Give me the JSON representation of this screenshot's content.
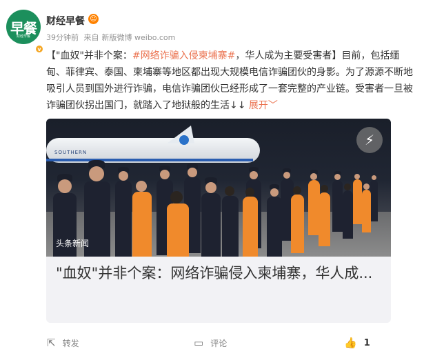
{
  "author": {
    "name": "财经早餐",
    "avatar_text": "早餐",
    "avatar_subtext": "财经早餐",
    "verify_badge": "v",
    "badge_icon": "emoji-badge-icon"
  },
  "meta": {
    "time": "39分钟前",
    "source_prefix": "来自",
    "source": "新版微博 weibo.com"
  },
  "post": {
    "prefix": "【\"血奴\"并非个案：",
    "hashtag": "#网络诈骗入侵柬埔寨#",
    "middle": "，华人成为主要受害者】目前，包括缅甸、菲律宾、泰国、柬埔寨等地区都出现大规模电信诈骗团伙的身影。为了源源不断地吸引人员到国外进行诈骗，电信诈骗团伙已经形成了一套完整的产业链。受害者一旦被诈骗团伙拐出国门，就踏入了地狱般的生活↓↓",
    "expand": "展开"
  },
  "link_card": {
    "watermark": "头条新闻",
    "title": "\"血奴\"并非个案：网络诈骗侵入柬埔寨，华人成...",
    "plane_text": "SOUTHERN"
  },
  "actions": {
    "share": "转发",
    "comment": "评论",
    "like_count": "1"
  },
  "colors": {
    "accent": "#eb7350",
    "avatar_bg": "#1c8f5c",
    "muted_text": "#939393"
  }
}
